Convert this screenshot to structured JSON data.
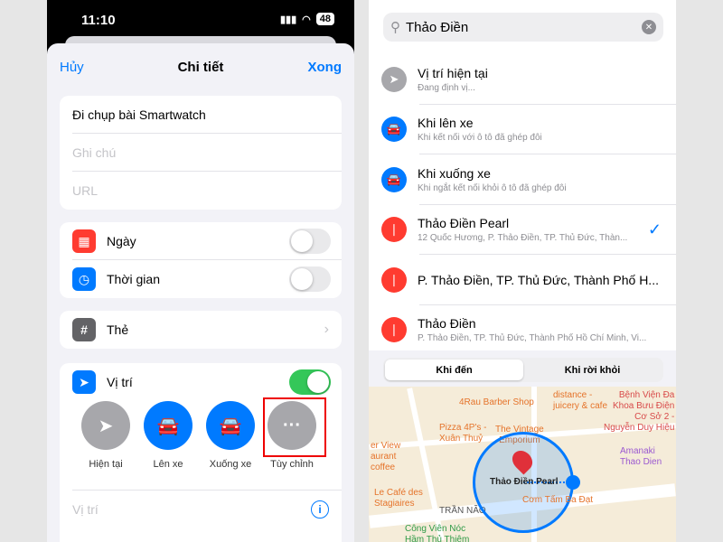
{
  "left": {
    "status": {
      "time": "11:10",
      "battery": "48"
    },
    "header": {
      "cancel": "Hủy",
      "title": "Chi tiết",
      "done": "Xong"
    },
    "fields": {
      "title": "Đi chụp bài Smartwatch",
      "notes_placeholder": "Ghi chú",
      "url_placeholder": "URL"
    },
    "date": {
      "label": "Ngày",
      "on": false
    },
    "time": {
      "label": "Thời gian",
      "on": false
    },
    "tags": {
      "label": "Thẻ"
    },
    "location": {
      "label": "Vị trí",
      "on": true,
      "options": [
        {
          "label": "Hiện tại",
          "icon": "location-arrow-icon",
          "color": "#a7a7ab"
        },
        {
          "label": "Lên xe",
          "icon": "car-icon",
          "color": "#007aff"
        },
        {
          "label": "Xuống xe",
          "icon": "car-icon",
          "color": "#007aff"
        },
        {
          "label": "Tùy chỉnh",
          "icon": "ellipsis-icon",
          "color": "#a7a7ab"
        }
      ],
      "highlighted": "Tùy chỉnh",
      "field_placeholder": "Vị trí"
    }
  },
  "right": {
    "search": {
      "value": "Thảo Điền"
    },
    "results": [
      {
        "title": "Vị trí hiện tại",
        "subtitle": "Đang định vị...",
        "icon": "location-arrow-icon",
        "color": "#a7a7ab"
      },
      {
        "title": "Khi lên xe",
        "subtitle": "Khi kết nối với ô tô đã ghép đôi",
        "icon": "car-icon",
        "color": "#007aff"
      },
      {
        "title": "Khi xuống xe",
        "subtitle": "Khi ngắt kết nối khỏi ô tô đã ghép đôi",
        "icon": "car-icon",
        "color": "#007aff"
      },
      {
        "title": "Thảo Điền Pearl",
        "subtitle": "12 Quốc Hương, P. Thảo Điền, TP. Thủ Đức, Thàn...",
        "icon": "pin-icon",
        "color": "#ff3b30",
        "selected": true
      },
      {
        "title": "P. Thảo Điền, TP. Thủ Đức, Thành Phố H...",
        "subtitle": "",
        "icon": "pin-icon",
        "color": "#ff3b30"
      },
      {
        "title": "Thảo Điền",
        "subtitle": "P. Thảo Điền, TP. Thủ Đức, Thành Phố Hồ Chí Minh, Vi...",
        "icon": "pin-icon",
        "color": "#ff3b30"
      }
    ],
    "segments": [
      "Khi đến",
      "Khi rời khỏi"
    ],
    "selected_segment": "Khi đến",
    "map": {
      "pin_label": "Thảo Điền Pearl",
      "labels": {
        "barber": "4Rau Barber Shop",
        "pizza": "Pizza 4P's -\nXuân Thuỷ",
        "vintage": "The Vintage\nEmporium",
        "distance": "distance -\njuicery & cafe",
        "hospital": "Bệnh Viện Đa\nKhoa Bưu Điện\nCơ Sở 2 -\nNguyễn Duy Hiệu",
        "amanaki": "Amanaki\nThao Dien",
        "river": "er View\naurant\ncoffee",
        "cafe": "Le Café des\nStagiaires",
        "street": "TRẦN NÃO",
        "com": "Cơm Tấm Ba Đạt",
        "park": "Công Viên Nóc\nHầm Thủ Thiêm"
      }
    }
  }
}
